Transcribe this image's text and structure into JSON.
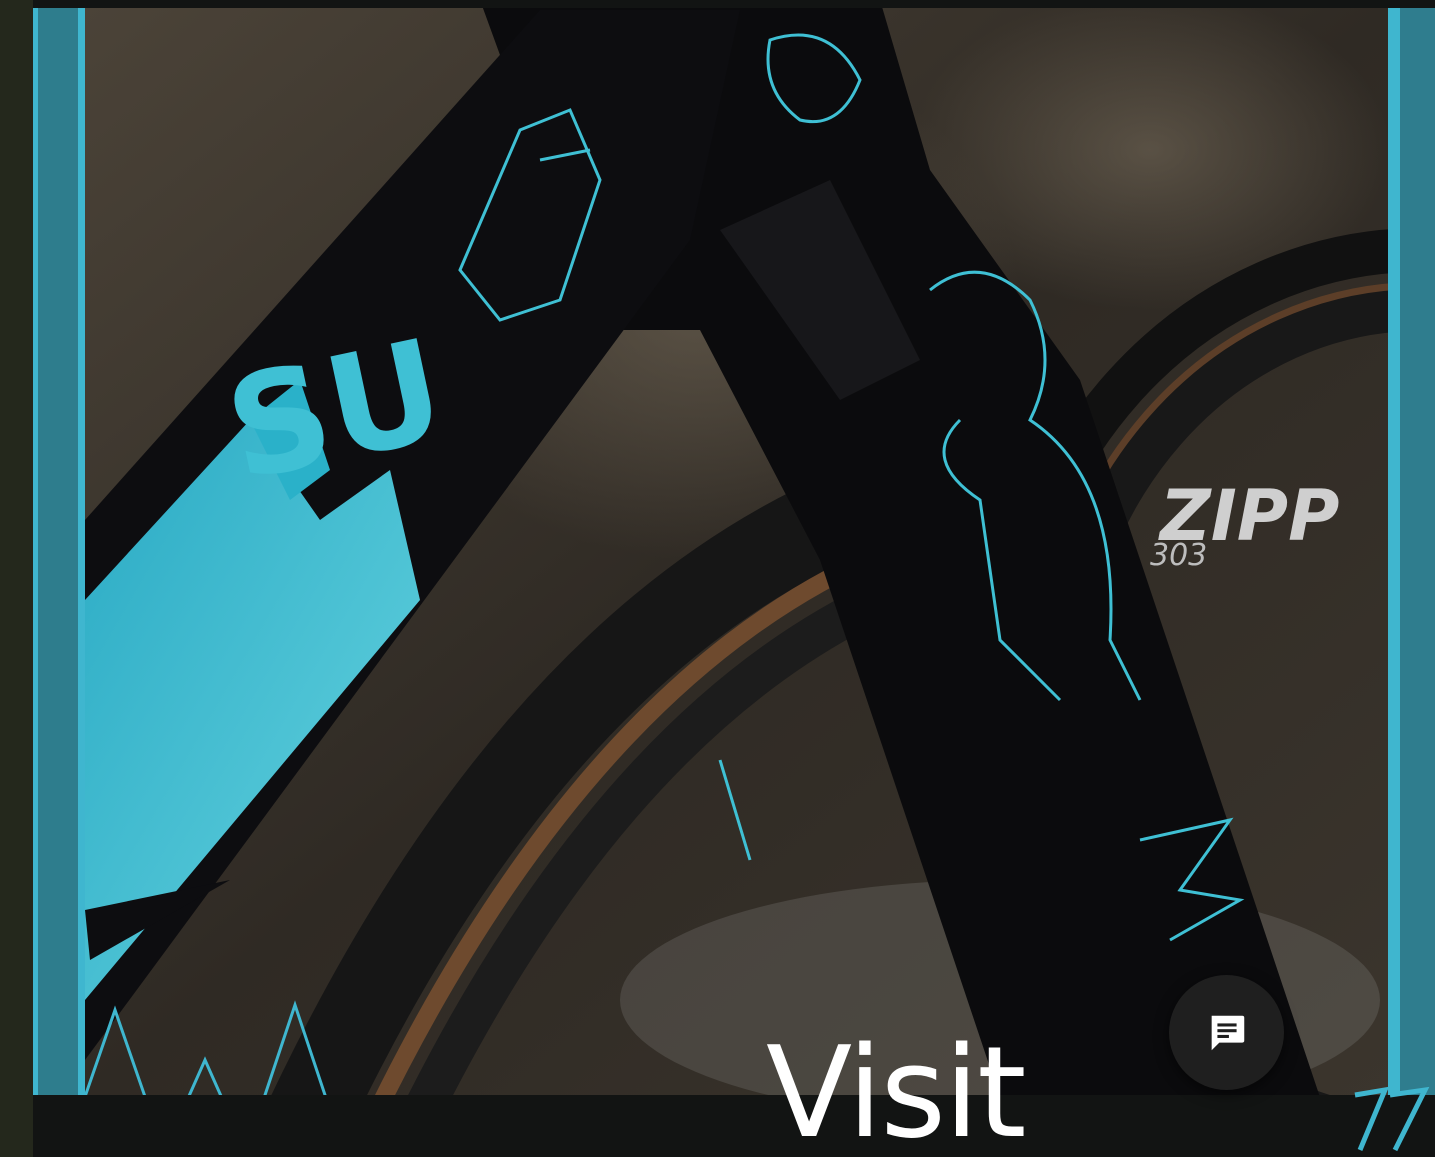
{
  "hero": {
    "visit_label": "Visit",
    "frame_accent_color": "#3fb6cf",
    "frame_color": "#121413"
  },
  "graphics": {
    "tube_brand_text": "SU",
    "rim_brand_text": "ZIPP",
    "rim_model_text": "303",
    "frame_logo_icon": "77-logo-icon"
  },
  "chat": {
    "icon": "chat-message-icon",
    "background_color": "#1f1f1f"
  }
}
